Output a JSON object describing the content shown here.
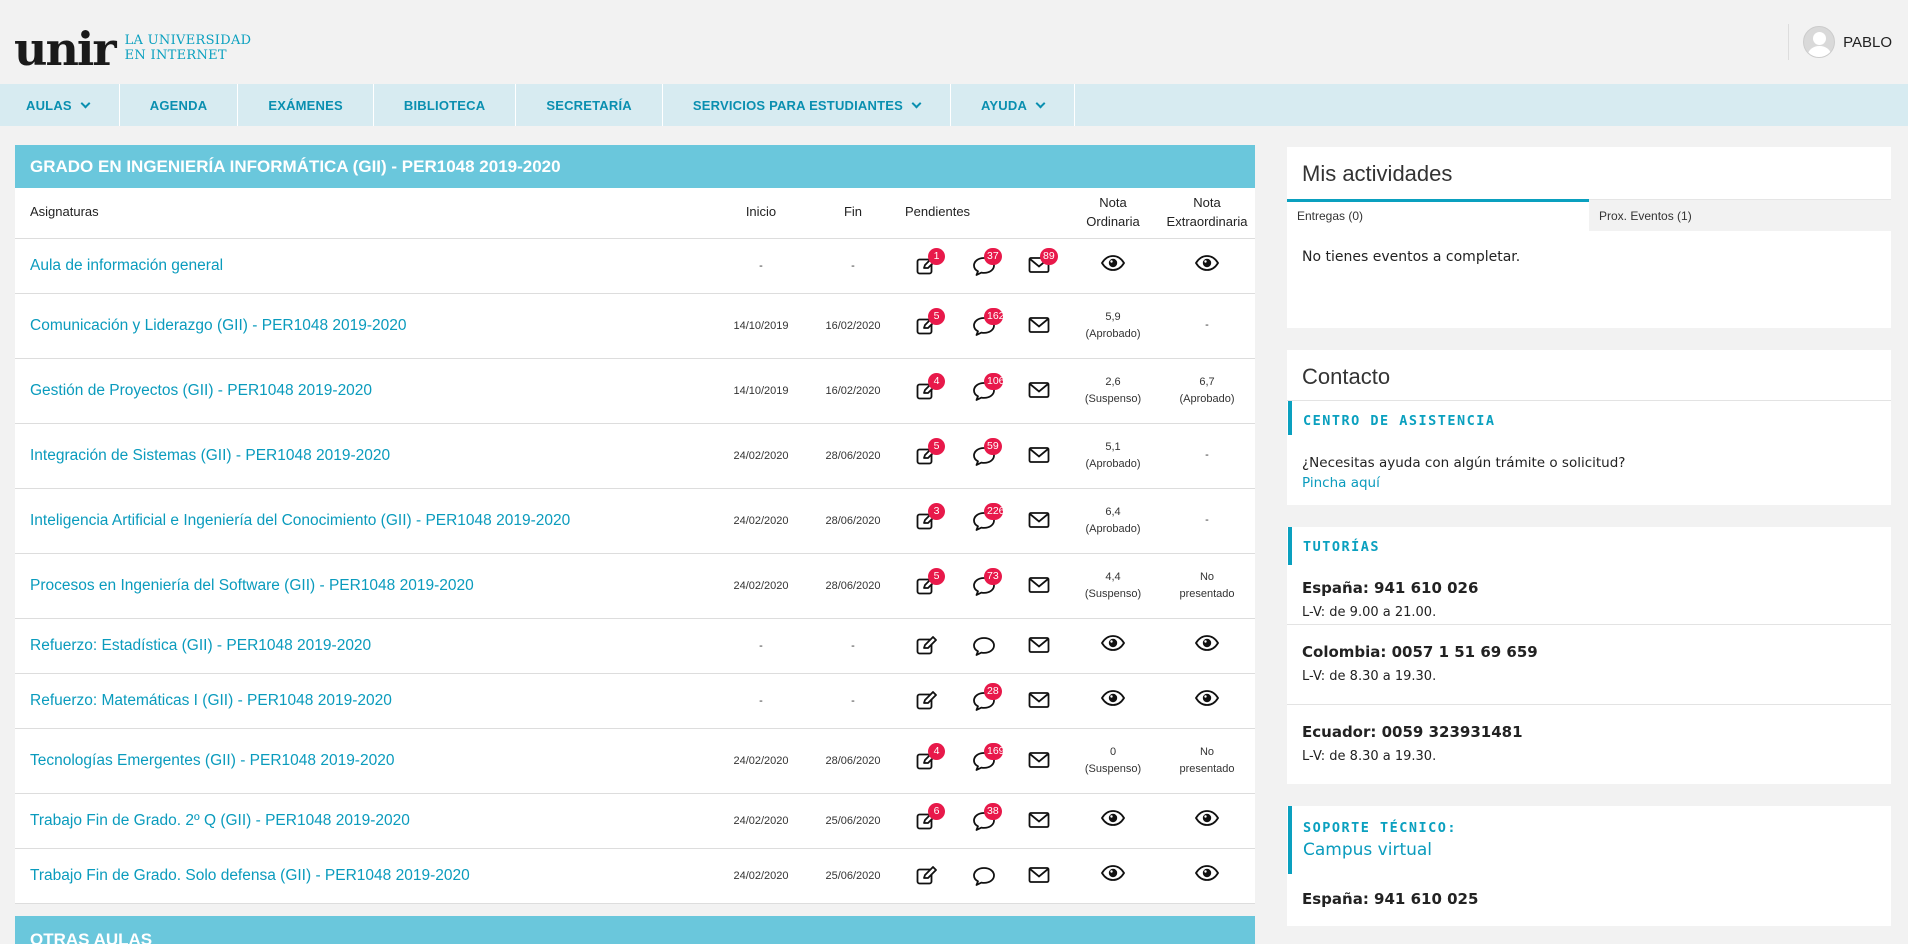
{
  "header": {
    "logo_text": "unir",
    "logo_sub_line1": "LA UNIVERSIDAD",
    "logo_sub_line2": "EN INTERNET",
    "user_name": "PABLO"
  },
  "nav": {
    "items": [
      {
        "label": "AULAS",
        "dropdown": true
      },
      {
        "label": "AGENDA",
        "dropdown": false
      },
      {
        "label": "EXÁMENES",
        "dropdown": false
      },
      {
        "label": "BIBLIOTECA",
        "dropdown": false
      },
      {
        "label": "SECRETARÍA",
        "dropdown": false
      },
      {
        "label": "SERVICIOS PARA ESTUDIANTES",
        "dropdown": true
      },
      {
        "label": "AYUDA",
        "dropdown": true
      }
    ]
  },
  "main": {
    "panel_title": "GRADO EN INGENIERÍA INFORMÁTICA (GII) - PER1048 2019-2020",
    "columns": {
      "subjects": "Asignaturas",
      "start": "Inicio",
      "end": "Fin",
      "pending": "Pendientes",
      "ordinary_line1": "Nota",
      "ordinary_line2": "Ordinaria",
      "extra_line1": "Nota",
      "extra_line2": "Extraordinaria"
    },
    "rows": [
      {
        "name": "Aula de información general",
        "start": "-",
        "end": "-",
        "tasks": "1",
        "forum": "37",
        "mail": "89",
        "ord_value": "",
        "ord_status": "",
        "ord_eye": true,
        "ext_value": "",
        "ext_status": "",
        "ext_eye": true
      },
      {
        "name": "Comunicación y Liderazgo (GII) - PER1048 2019-2020",
        "start": "14/10/2019",
        "end": "16/02/2020",
        "tasks": "5",
        "forum": "162",
        "mail": "",
        "ord_value": "5,9",
        "ord_status": "(Aprobado)",
        "ord_eye": false,
        "ext_value": "-",
        "ext_status": "",
        "ext_eye": false
      },
      {
        "name": "Gestión de Proyectos (GII) - PER1048 2019-2020",
        "start": "14/10/2019",
        "end": "16/02/2020",
        "tasks": "4",
        "forum": "106",
        "mail": "",
        "ord_value": "2,6",
        "ord_status": "(Suspenso)",
        "ord_eye": false,
        "ext_value": "6,7",
        "ext_status": "(Aprobado)",
        "ext_eye": false
      },
      {
        "name": "Integración de Sistemas (GII) - PER1048 2019-2020",
        "start": "24/02/2020",
        "end": "28/06/2020",
        "tasks": "5",
        "forum": "59",
        "mail": "",
        "ord_value": "5,1",
        "ord_status": "(Aprobado)",
        "ord_eye": false,
        "ext_value": "-",
        "ext_status": "",
        "ext_eye": false
      },
      {
        "name": "Inteligencia Artificial e Ingeniería del Conocimiento (GII) - PER1048 2019-2020",
        "start": "24/02/2020",
        "end": "28/06/2020",
        "tasks": "3",
        "forum": "226",
        "mail": "",
        "ord_value": "6,4",
        "ord_status": "(Aprobado)",
        "ord_eye": false,
        "ext_value": "-",
        "ext_status": "",
        "ext_eye": false
      },
      {
        "name": "Procesos en Ingeniería del Software (GII) - PER1048 2019-2020",
        "start": "24/02/2020",
        "end": "28/06/2020",
        "tasks": "5",
        "forum": "73",
        "mail": "",
        "ord_value": "4,4",
        "ord_status": "(Suspenso)",
        "ord_eye": false,
        "ext_value": "No",
        "ext_status": "presentado",
        "ext_eye": false
      },
      {
        "name": "Refuerzo: Estadística (GII) - PER1048 2019-2020",
        "start": "-",
        "end": "-",
        "tasks": "",
        "forum": "",
        "mail": "",
        "ord_value": "",
        "ord_status": "",
        "ord_eye": true,
        "ext_value": "",
        "ext_status": "",
        "ext_eye": true
      },
      {
        "name": "Refuerzo: Matemáticas I (GII) - PER1048 2019-2020",
        "start": "-",
        "end": "-",
        "tasks": "",
        "forum": "28",
        "mail": "",
        "ord_value": "",
        "ord_status": "",
        "ord_eye": true,
        "ext_value": "",
        "ext_status": "",
        "ext_eye": true
      },
      {
        "name": "Tecnologías Emergentes (GII) - PER1048 2019-2020",
        "start": "24/02/2020",
        "end": "28/06/2020",
        "tasks": "4",
        "forum": "169",
        "mail": "",
        "ord_value": "0",
        "ord_status": "(Suspenso)",
        "ord_eye": false,
        "ext_value": "No",
        "ext_status": "presentado",
        "ext_eye": false
      },
      {
        "name": "Trabajo Fin de Grado. 2º Q (GII) - PER1048 2019-2020",
        "start": "24/02/2020",
        "end": "25/06/2020",
        "tasks": "6",
        "forum": "38",
        "mail": "",
        "ord_value": "",
        "ord_status": "",
        "ord_eye": true,
        "ext_value": "",
        "ext_status": "",
        "ext_eye": true
      },
      {
        "name": "Trabajo Fin de Grado. Solo defensa (GII) - PER1048 2019-2020",
        "start": "24/02/2020",
        "end": "25/06/2020",
        "tasks": "",
        "forum": "",
        "mail": "",
        "ord_value": "",
        "ord_status": "",
        "ord_eye": true,
        "ext_value": "",
        "ext_status": "",
        "ext_eye": true
      }
    ],
    "other_title": "OTRAS AULAS"
  },
  "activities": {
    "title": "Mis actividades",
    "tab_deliveries": "Entregas (0)",
    "tab_events": "Prox. Eventos (1)",
    "empty_text": "No tienes eventos a completar."
  },
  "contact": {
    "title": "Contacto",
    "assistance_title": "CENTRO DE ASISTENCIA",
    "assistance_question": "¿Necesitas ayuda con algún trámite o solicitud?",
    "assistance_link": "Pincha aquí",
    "tutorias_title": "TUTORÍAS",
    "tutorias": [
      {
        "phone": "España: 941 610 026",
        "hours": "L-V: de 9.00 a 21.00."
      },
      {
        "phone": "Colombia: 0057 1 51 69 659",
        "hours": "L-V: de 8.30 a 19.30."
      },
      {
        "phone": "Ecuador: 0059 323931481",
        "hours": "L-V: de 8.30 a 19.30."
      }
    ],
    "support_title": "SOPORTE TÉCNICO:",
    "support_subtitle": "Campus virtual",
    "support_phone": "España: 941 610 025"
  },
  "colors": {
    "accent": "#0aa0bf",
    "panel_header": "#6ac7dc",
    "nav_bg": "#d7ebf1",
    "badge": "#e8194a"
  }
}
